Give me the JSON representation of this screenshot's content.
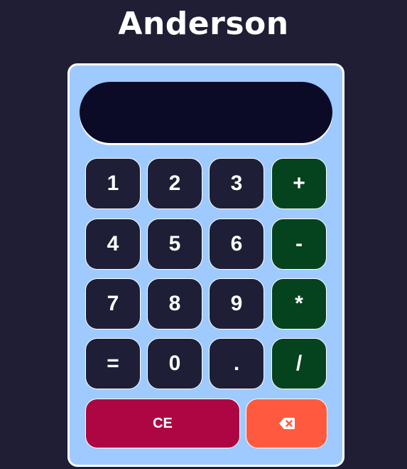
{
  "app": {
    "title": "Anderson"
  },
  "display": {
    "value": ""
  },
  "keys": {
    "k1": "1",
    "k2": "2",
    "k3": "3",
    "plus": "+",
    "k4": "4",
    "k5": "5",
    "k6": "6",
    "minus": "-",
    "k7": "7",
    "k8": "8",
    "k9": "9",
    "multiply": "*",
    "equals": "=",
    "k0": "0",
    "decimal": ".",
    "divide": "/",
    "clear_entry": "CE",
    "backspace_icon": "backspace-icon"
  },
  "colors": {
    "background": "#1f1e35",
    "panel": "#9ecaff",
    "display": "#0b0b27",
    "number_key": "#1e1f36",
    "operator_key": "#04431d",
    "clear_key": "#ad0642",
    "backspace_key": "#ff5a40"
  }
}
